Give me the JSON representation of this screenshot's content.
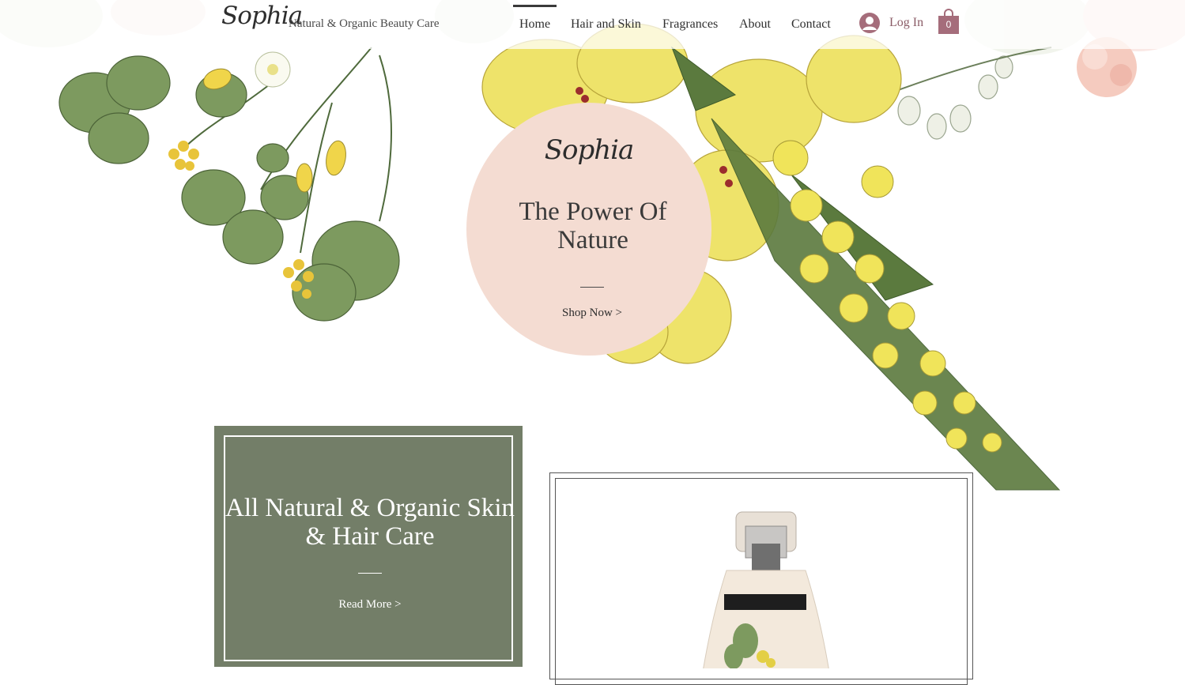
{
  "brand": {
    "logo_text": "Sophia",
    "tagline": "Natural & Organic Beauty Care"
  },
  "nav": {
    "items": [
      {
        "label": "Home",
        "active": true
      },
      {
        "label": "Hair and Skin"
      },
      {
        "label": "Fragrances"
      },
      {
        "label": "About"
      },
      {
        "label": "Contact"
      }
    ]
  },
  "account": {
    "login_label": "Log In",
    "avatar_icon": "user-avatar-icon"
  },
  "cart": {
    "count": "0",
    "icon": "shopping-bag-icon",
    "color": "#a56d7b"
  },
  "hero": {
    "logo_text": "Sophia",
    "title": "The Power Of Nature",
    "cta": "Shop Now >",
    "circle_color": "#f4dcd2"
  },
  "promo": {
    "title": "All Natural & Organic Skin & Hair Care",
    "cta": "Read More >",
    "background": "#737e68"
  },
  "product": {
    "image": "spray-bottle-product-image"
  }
}
